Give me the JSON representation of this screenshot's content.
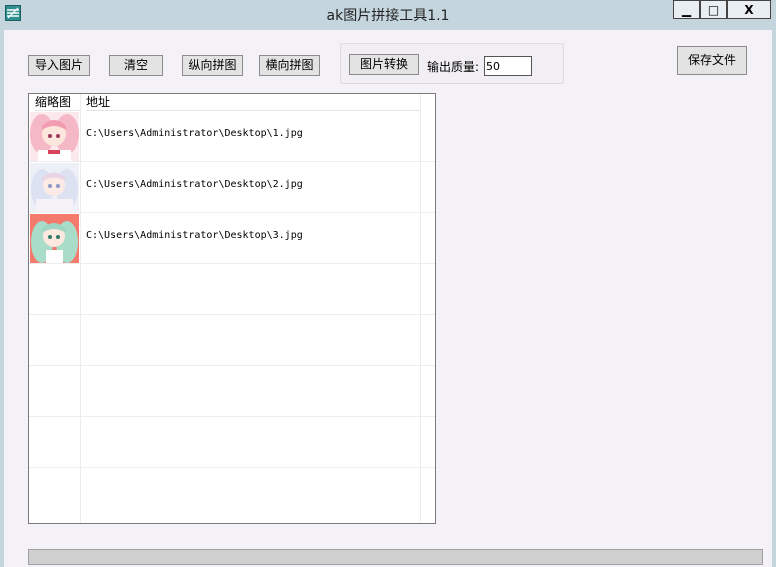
{
  "window": {
    "title": "ak图片拼接工具1.1",
    "minimize_label": "▁",
    "maximize_label": "□",
    "close_label": "X"
  },
  "toolbar": {
    "import": "导入图片",
    "clear": "清空",
    "vertical": "纵向拼图",
    "horizontal": "横向拼图",
    "convert": "图片转换",
    "quality_label": "输出质量:",
    "quality_value": "50",
    "save": "保存文件"
  },
  "grid": {
    "columns": [
      "缩略图",
      "地址"
    ],
    "rows": [
      {
        "path": "C:\\Users\\Administrator\\Desktop\\1.jpg"
      },
      {
        "path": "C:\\Users\\Administrator\\Desktop\\2.jpg"
      },
      {
        "path": "C:\\Users\\Administrator\\Desktop\\3.jpg"
      }
    ]
  },
  "colors": {
    "titlebar": "#c4d5dd",
    "client": "#f5f2f7",
    "button": "#e3e3e3"
  }
}
